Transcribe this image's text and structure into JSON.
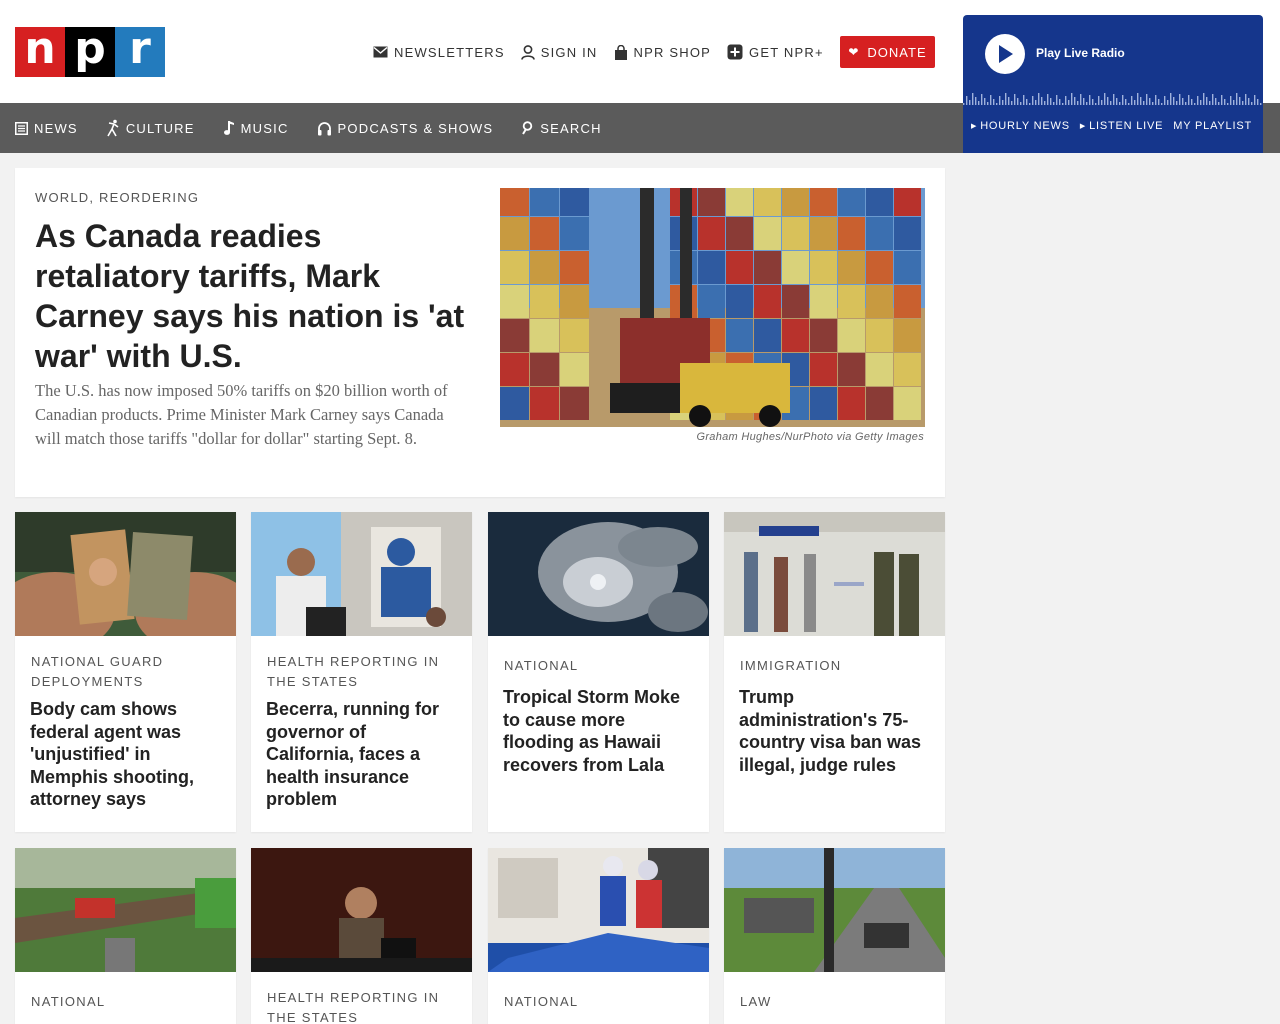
{
  "header": {
    "logo": [
      "n",
      "p",
      "r"
    ],
    "links": [
      {
        "label": "NEWSLETTERS",
        "icon": "envelope-icon"
      },
      {
        "label": "SIGN IN",
        "icon": "user-icon"
      },
      {
        "label": "NPR SHOP",
        "icon": "shopping-bag-icon"
      },
      {
        "label": "GET NPR+",
        "icon": "plus-square-icon"
      }
    ],
    "donate_label": "DONATE",
    "colors": {
      "brand_red": "#d62021",
      "brand_black": "#000000",
      "brand_blue": "#237bbd",
      "player_blue": "#15368c",
      "nav_gray": "#5b5b5b"
    }
  },
  "player": {
    "play_label": "Play Live Radio",
    "links": [
      "HOURLY NEWS",
      "LISTEN LIVE",
      "MY PLAYLIST"
    ]
  },
  "nav": {
    "items": [
      {
        "label": "NEWS",
        "icon": "newspaper-icon"
      },
      {
        "label": "CULTURE",
        "icon": "dancer-icon"
      },
      {
        "label": "MUSIC",
        "icon": "music-note-icon"
      },
      {
        "label": "PODCASTS & SHOWS",
        "icon": "headphones-icon"
      },
      {
        "label": "SEARCH",
        "icon": "search-icon"
      }
    ]
  },
  "lead": {
    "slug": "WORLD, REORDERING",
    "title": "As Canada readies retaliatory tariffs, Mark Carney says his nation is 'at war' with U.S.",
    "teaser": "The U.S. has now imposed 50% tariffs on $20 billion worth of Canadian products. Prime Minister Mark Carney says Canada will match those tariffs \"dollar for dollar\" starting Sept. 8.",
    "image_credit": "Graham Hughes/NurPhoto via Getty Images"
  },
  "stories": [
    {
      "slug": "NATIONAL GUARD DEPLOYMENTS",
      "title": "Body cam shows federal agent was 'unjustified' in Memphis shooting, attorney says"
    },
    {
      "slug": "HEALTH REPORTING IN THE STATES",
      "title": "Becerra, running for governor of California, faces a health insurance problem"
    },
    {
      "slug": "NATIONAL",
      "title": "Tropical Storm Moke to cause more flooding as Hawaii recovers from Lala"
    },
    {
      "slug": "IMMIGRATION",
      "title": "Trump administration's 75-country visa ban was illegal, judge rules"
    },
    {
      "slug": "NATIONAL",
      "title": ""
    },
    {
      "slug": "HEALTH REPORTING IN THE STATES",
      "title": ""
    },
    {
      "slug": "NATIONAL",
      "title": ""
    },
    {
      "slug": "LAW",
      "title": ""
    }
  ]
}
